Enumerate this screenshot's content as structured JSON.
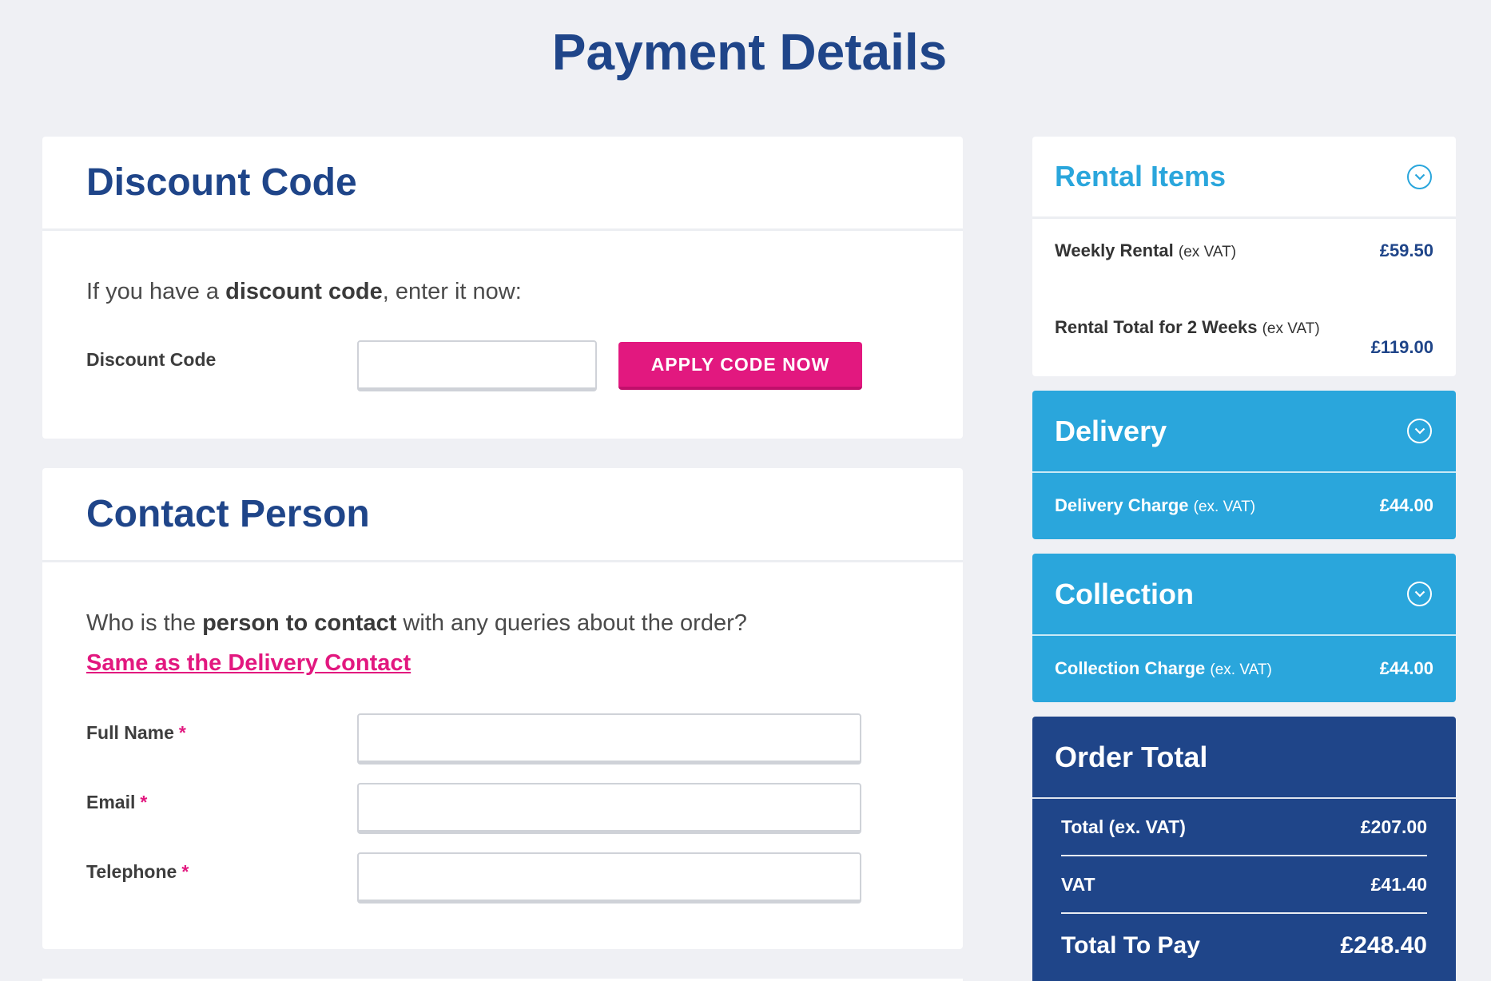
{
  "page": {
    "title": "Payment Details"
  },
  "discount": {
    "heading": "Discount Code",
    "lead_prefix": "If you have a ",
    "lead_bold": "discount code",
    "lead_suffix": ", enter it now:",
    "field_label": "Discount Code",
    "input_value": "",
    "button_label": "APPLY CODE NOW"
  },
  "contact": {
    "heading": "Contact Person",
    "lead_prefix": "Who is the ",
    "lead_bold": "person to contact",
    "lead_suffix": " with any queries about the order?",
    "same_as_link": "Same as the Delivery Contact",
    "required_mark": "*",
    "fields": [
      {
        "label": "Full Name",
        "value": ""
      },
      {
        "label": "Email",
        "value": ""
      },
      {
        "label": "Telephone",
        "value": ""
      }
    ]
  },
  "rental": {
    "heading": "Rental Items",
    "weekly_label": "Weekly Rental",
    "weekly_sub": "(ex VAT)",
    "weekly_amount": "£59.50",
    "total_label": "Rental Total for 2 Weeks",
    "total_sub": "(ex VAT)",
    "total_amount": "£119.00"
  },
  "delivery": {
    "heading": "Delivery",
    "charge_label": "Delivery Charge",
    "charge_sub": "(ex. VAT)",
    "charge_amount": "£44.00"
  },
  "collection": {
    "heading": "Collection",
    "charge_label": "Collection Charge",
    "charge_sub": "(ex. VAT)",
    "charge_amount": "£44.00"
  },
  "order": {
    "heading": "Order Total",
    "rows": [
      {
        "label": "Total (ex. VAT)",
        "amount": "£207.00"
      },
      {
        "label": "VAT",
        "amount": "£41.40"
      },
      {
        "label": "Total To Pay",
        "amount": "£248.40"
      }
    ]
  },
  "colors": {
    "navy": "#1f4589",
    "sky": "#2aa6dc",
    "pink": "#e2187f",
    "background": "#eff0f4"
  },
  "icons": {
    "expand": "chevron-down-circle-icon"
  }
}
